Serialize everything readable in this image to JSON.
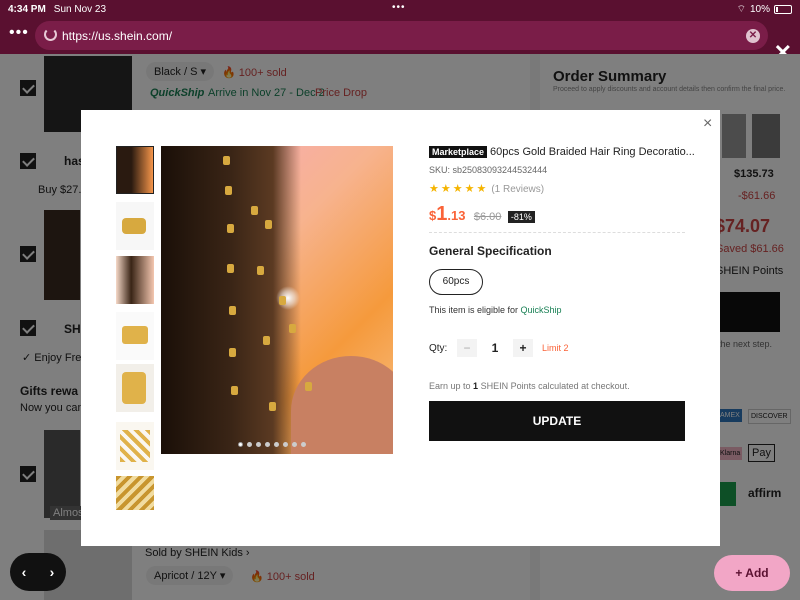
{
  "status_bar": {
    "time": "4:34 PM",
    "date": "Sun Nov 23",
    "battery": "10%"
  },
  "browser": {
    "url": "https://us.shein.com/"
  },
  "background": {
    "item1": {
      "variant": "Black / S",
      "sold": "100+ sold",
      "quickship": "QuickShip",
      "arrive": "Arrive in Nov 27 - Dec 2",
      "price_drop": "Price Drop"
    },
    "item2_partial": "has",
    "buy_partial": "Buy $27.8",
    "shein_partial": "SH",
    "enjoy_partial": "Enjoy Free",
    "gifts_title": "Gifts rewa",
    "gifts_sub": "Now you can g",
    "almost_partial": "Almos",
    "sold_by": "Sold by SHEIN Kids",
    "item3_variant": "Apricot / 12Y",
    "item3_sold": "100+ sold",
    "order_summary": {
      "title": "Order Summary",
      "subtitle": "Proceed to apply discounts and account details then confirm the final price.",
      "price1": "$135.73",
      "saving1": "-$61.66",
      "total": "$74.07",
      "saved": "Saved $61.66",
      "points": "SHEIN Points",
      "next_step": "the next step."
    },
    "payments": [
      "AMEX",
      "DISCOVER",
      "Klarna",
      "Pay",
      "affirm"
    ]
  },
  "modal": {
    "tag": "Marketplace",
    "title": "60pcs Gold Braided Hair Ring Decoratio...",
    "sku": "SKU: sb25083093244532444",
    "stars": "★★★★★",
    "reviews": "(1 Reviews)",
    "price_currency": "$",
    "price_int": "1",
    "price_cents": ".13",
    "old_price": "$6.00",
    "discount": "-81%",
    "spec_title": "General Specification",
    "spec_option": "60pcs",
    "quickship_prefix": "This item is eligible for",
    "quickship_link": "QuickShip",
    "qty_label": "Qty:",
    "qty_minus": "−",
    "qty_value": "1",
    "qty_plus": "+",
    "qty_limit": "Limit 2",
    "points_prefix": "Earn up to",
    "points_value": "1",
    "points_suffix": "SHEIN Points calculated at checkout.",
    "update_label": "UPDATE",
    "close": "×",
    "image_dots": 8
  },
  "bottom": {
    "back": "‹",
    "forward": "›",
    "add_label": "Add",
    "add_icon": "+"
  }
}
